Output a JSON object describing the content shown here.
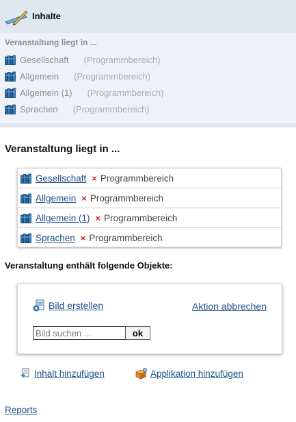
{
  "panel": {
    "title": "Inhalte",
    "subtitle": "Veranstaltung liegt in ...",
    "items": [
      {
        "name": "Gesellschaft",
        "type": "(Programmbereich)"
      },
      {
        "name": "Allgemein",
        "type": "(Programmbereich)"
      },
      {
        "name": "Allgemein (1)",
        "type": "(Programmbereich)"
      },
      {
        "name": "Sprachen",
        "type": "(Programmbereich)"
      }
    ]
  },
  "main": {
    "heading_liegt": "Veranstaltung liegt in ...",
    "locations": [
      {
        "name": "Gesellschaft",
        "type": "Programmbereich"
      },
      {
        "name": "Allgemein",
        "type": "Programmbereich"
      },
      {
        "name": "Allgemein (1)",
        "type": "Programmbereich"
      },
      {
        "name": "Sprachen",
        "type": "Programmbereich"
      }
    ],
    "remove_mark": "×",
    "heading_enthaelt": "Veranstaltung enthält folgende Objekte:",
    "create_image_label": "Bild erstellen",
    "cancel_action_label": "Aktion abbrechen",
    "search_placeholder": "Bild suchen ...",
    "ok_label": "ok",
    "add_content_label": "Inhalt hinzufügen",
    "add_application_label": "Applikation hinzufügen",
    "reports_label": "Reports"
  },
  "colors": {
    "link": "#1f4f8a",
    "panel_bg": "#eef2f6",
    "panel_header_bg": "#dfe7f0",
    "remove_mark": "#d02020"
  },
  "icons": {
    "header": "pen-ruler-icon",
    "item": "books-icon",
    "create_image": "image-document-icon",
    "add_content": "add-content-icon",
    "add_application": "application-box-icon"
  }
}
